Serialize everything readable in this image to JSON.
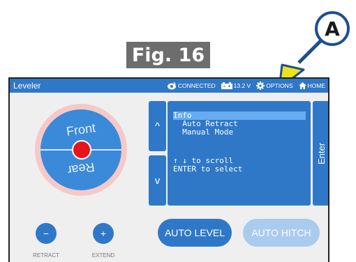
{
  "figure": {
    "label": "Fig. 16",
    "callout": "A"
  },
  "header": {
    "title": "Leveler",
    "connection": "CONNECTED",
    "voltage": "13.2 V",
    "options": "OPTIONS",
    "home": "HOME"
  },
  "dial": {
    "front": "Front",
    "rear": "Rear"
  },
  "menu": {
    "up": "^",
    "down": "v",
    "items": [
      {
        "label": "Info",
        "selected": true
      },
      {
        "label": "  Auto Retract",
        "selected": false
      },
      {
        "label": "  Manual Mode",
        "selected": false
      }
    ],
    "hint_line1": "↑ ↓ to scroll",
    "hint_line2": "ENTER to select",
    "enter": "Enter"
  },
  "controls": {
    "retract_symbol": "−",
    "retract_label": "RETRACT",
    "extend_symbol": "+",
    "extend_label": "EXTEND",
    "auto_level": "AUTO LEVEL",
    "auto_hitch": "AUTO HITCH"
  },
  "colors": {
    "accent": "#2f78c8",
    "disabled": "#a9cbee",
    "bubble": "#e8141b",
    "ring": "#f6c9c9",
    "callout_arrow": "#f0e21a"
  }
}
